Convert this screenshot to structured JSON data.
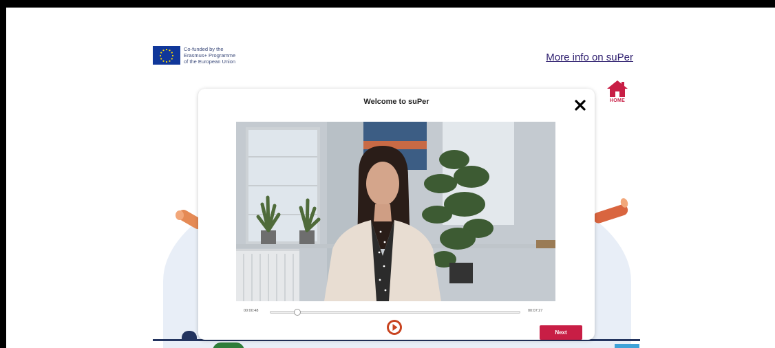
{
  "header": {
    "eu_logo_lines": [
      "Co-funded by the",
      "Erasmus+ Programme",
      "of the European Union"
    ],
    "more_info_link": "More info on suPer",
    "home_label": "HOME",
    "home_icon": "home-icon",
    "flag_icon": "eu-flag-icon"
  },
  "modal": {
    "title": "Welcome to suPer",
    "close_icon": "close-icon",
    "video": {
      "elapsed": "00:00:48",
      "total": "00:07:27",
      "progress_fraction": 0.107
    },
    "play_icon": "play-icon",
    "next_label": "Next"
  },
  "colors": {
    "accent": "#c81e45",
    "link": "#2d1d6e",
    "eu_blue": "#10379a",
    "eu_star": "#ffdd00"
  }
}
